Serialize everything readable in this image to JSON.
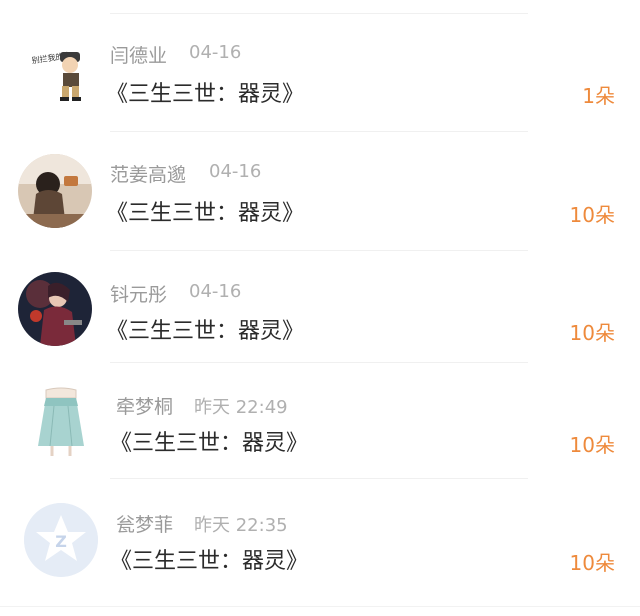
{
  "gifts": [
    {
      "user": "闫德业",
      "time": "04-16",
      "title": "《三生三世：器灵》",
      "count": "1朵",
      "avatar_icon": "cartoon-sticker-avatar",
      "avatar_text": "别拦我的人"
    },
    {
      "user": "范姜高邈",
      "time": "04-16",
      "title": "《三生三世：器灵》",
      "count": "10朵",
      "avatar_icon": "girl-photo-avatar"
    },
    {
      "user": "钭元彤",
      "time": "04-16",
      "title": "《三生三世：器灵》",
      "count": "10朵",
      "avatar_icon": "game-character-avatar"
    },
    {
      "user": "牵梦桐",
      "time": "昨天 22:49",
      "title": "《三生三世：器灵》",
      "count": "10朵",
      "avatar_icon": "skirt-illustration-avatar"
    },
    {
      "user": "瓮梦菲",
      "time": "昨天 22:35",
      "title": "《三生三世：器灵》",
      "count": "10朵",
      "avatar_icon": "default-star-avatar"
    }
  ],
  "colors": {
    "accent": "#ee8a3c",
    "name": "#9a9a9a",
    "title": "#2b2b2b",
    "divider": "#f0f0f0"
  }
}
